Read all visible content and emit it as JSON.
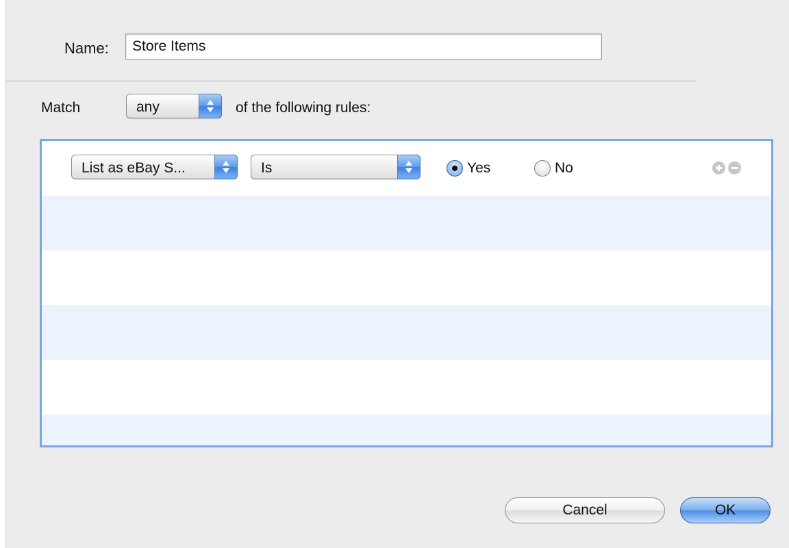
{
  "dialog": {
    "name_label": "Name:",
    "name_value": "Store Items",
    "match_label": "Match",
    "match_selected": "any",
    "following_text": "of the following rules:"
  },
  "rules": [
    {
      "field": "List as eBay S...",
      "operator": "Is",
      "yes_label": "Yes",
      "no_label": "No",
      "selected": "Yes"
    }
  ],
  "buttons": {
    "cancel": "Cancel",
    "ok": "OK"
  },
  "colors": {
    "accent": "#5d9ae8",
    "list_border": "#7aa6e2",
    "stripe": "#edf3fd"
  },
  "icons": {
    "popup_arrows": "up-down-arrows-icon",
    "add_rule": "plus-icon",
    "remove_rule": "minus-icon"
  }
}
